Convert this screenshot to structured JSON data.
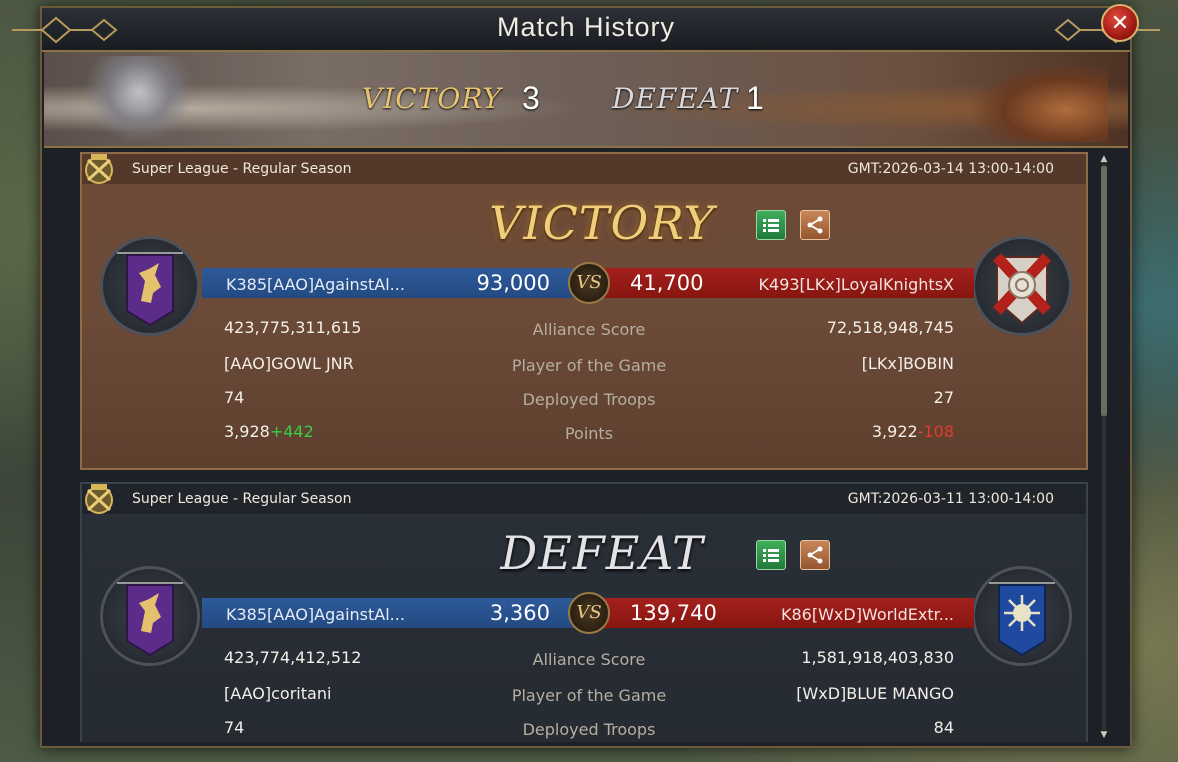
{
  "window": {
    "title": "Match History",
    "close_icon": "close-icon"
  },
  "summary": {
    "victory_label": "VICTORY",
    "victory_count": "3",
    "defeat_label": "DEFEAT",
    "defeat_count": "1"
  },
  "matches": [
    {
      "league": "Super League - Regular Season",
      "gmt": "GMT:2026-03-14 13:00-14:00",
      "result": "VICTORY",
      "left_name": "K385[AAO]AgainstAl...",
      "left_score": "93,000",
      "vs": "VS",
      "right_score": "41,700",
      "right_name": "K493[LKx]LoyalKnightsX",
      "stats": [
        {
          "label": "Alliance Score",
          "left": "423,775,311,615",
          "right": "72,518,948,745"
        },
        {
          "label": "Player of the Game",
          "left": "[AAO]GOWL JNR",
          "right": "[LKx]BOBIN"
        },
        {
          "label": "Deployed Troops",
          "left": "74",
          "right": "27"
        }
      ],
      "points": {
        "label": "Points",
        "left": "3,928",
        "left_delta": "+442",
        "right": "3,922",
        "right_delta": "-108"
      },
      "left_crest_icon": "unicorn-purple-banner-icon",
      "right_crest_icon": "red-saltire-shield-icon"
    },
    {
      "league": "Super League - Regular Season",
      "gmt": "GMT:2026-03-11 13:00-14:00",
      "result": "DEFEAT",
      "left_name": "K385[AAO]AgainstAl...",
      "left_score": "3,360",
      "vs": "VS",
      "right_score": "139,740",
      "right_name": "K86[WxD]WorldExtr...",
      "stats": [
        {
          "label": "Alliance Score",
          "left": "423,774,412,512",
          "right": "1,581,918,403,830"
        },
        {
          "label": "Player of the Game",
          "left": "[AAO]coritani",
          "right": "[WxD]BLUE MANGO"
        },
        {
          "label": "Deployed Troops",
          "left": "74",
          "right": "84"
        }
      ],
      "left_crest_icon": "unicorn-purple-banner-icon",
      "right_crest_icon": "sun-blue-banner-icon"
    }
  ],
  "colors": {
    "victory_gold": "#f1cf7a",
    "left_team_blue": "#2e5a9a",
    "right_team_red": "#a5201d",
    "points_gain": "#38d048",
    "points_loss": "#e23b2f"
  }
}
